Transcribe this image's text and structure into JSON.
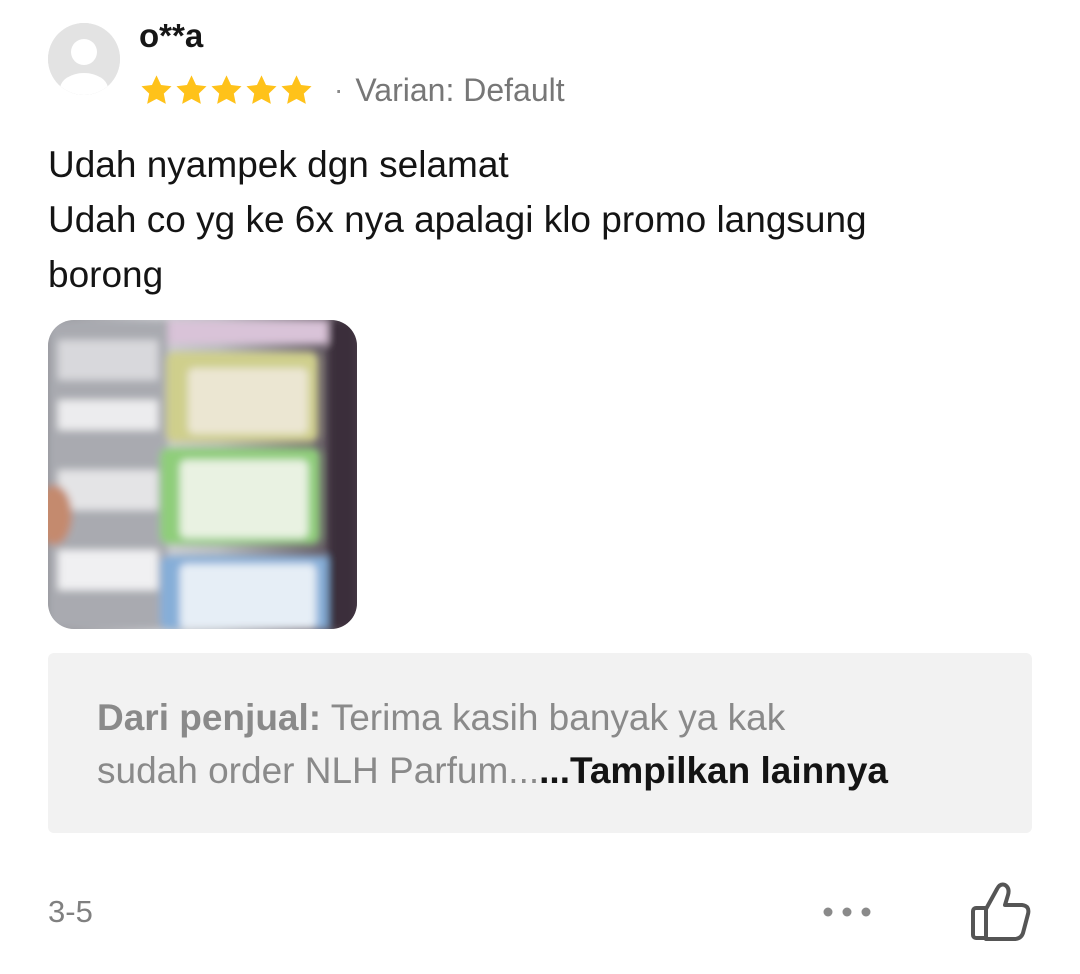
{
  "review": {
    "username": "o**a",
    "rating": 5,
    "rating_max": 5,
    "separator": "·",
    "variant_text": "Varian: Default",
    "body_lines": [
      "Udah nyampek dgn selamat",
      "Udah co yg ke 6x nya apalagi klo promo langsung",
      "borong"
    ],
    "photo_count": 1,
    "seller_reply": {
      "label": "Dari penjual:",
      "text_line1": " Terima kasih banyak ya kak",
      "text_line2": "sudah order NLH Parfum...",
      "more_label": "...Tampilkan lainnya"
    },
    "date": "3-5",
    "more_icon": "more-horizontal-icon",
    "like_icon": "thumbs-up-icon"
  },
  "colors": {
    "star": "#FFC21A",
    "text_primary": "#141414",
    "text_secondary": "#808080",
    "reply_background": "#F2F2F2"
  }
}
